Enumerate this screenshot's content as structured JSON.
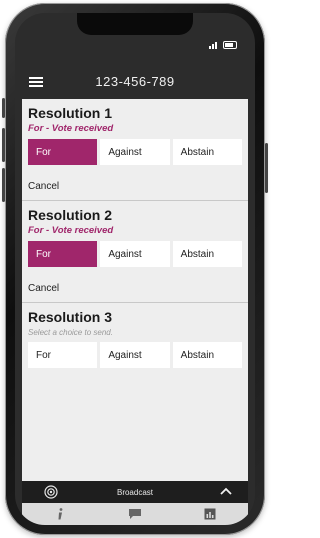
{
  "header": {
    "title": "123-456-789"
  },
  "resolutions": [
    {
      "title": "Resolution 1",
      "status": "For - Vote received",
      "choices": [
        "For",
        "Against",
        "Abstain"
      ],
      "selected": "For",
      "cancel_label": "Cancel"
    },
    {
      "title": "Resolution 2",
      "status": "For - Vote received",
      "choices": [
        "For",
        "Against",
        "Abstain"
      ],
      "selected": "For",
      "cancel_label": "Cancel"
    },
    {
      "title": "Resolution 3",
      "hint": "Select a choice to send.",
      "choices": [
        "For",
        "Against",
        "Abstain"
      ],
      "selected": null
    }
  ],
  "broadcast_bar": {
    "label": "Broadcast",
    "icon": "broadcast-icon",
    "toggle_icon": "chevron-up-icon"
  },
  "tabbar": {
    "icons": [
      "info-icon",
      "chat-icon",
      "chart-icon"
    ]
  },
  "colors": {
    "accent": "#a0266b",
    "background": "#eeeeee",
    "header": "#2c2c2c"
  }
}
